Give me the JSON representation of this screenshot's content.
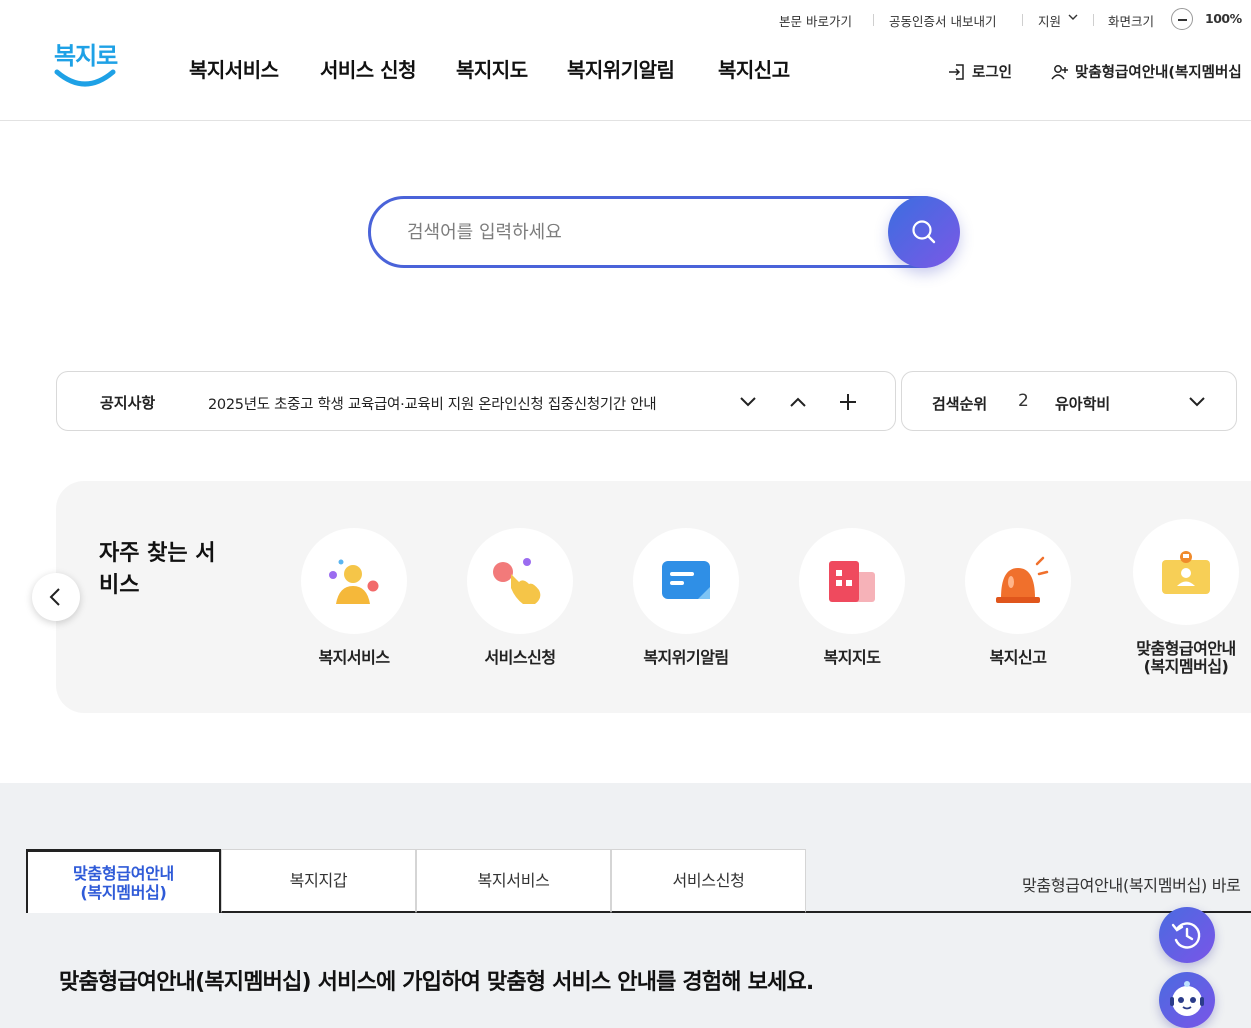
{
  "utility": {
    "skip_to_content": "본문 바로가기",
    "cert_export": "공동인증서 내보내기",
    "support": "지원",
    "screen_size": "화면크기",
    "zoom_level": "100%"
  },
  "header": {
    "logo_text": "복지로",
    "nav": [
      "복지서비스",
      "서비스 신청",
      "복지지도",
      "복지위기알림",
      "복지신고"
    ],
    "login": "로그인",
    "membership": "맞춤형급여안내(복지멤버십"
  },
  "search": {
    "placeholder": "검색어를 입력하세요"
  },
  "notice": {
    "label": "공지사항",
    "text": "2025년도 초중고 학생 교육급여·교육비 지원 온라인신청 집중신청기간 안내"
  },
  "ranking": {
    "label": "검색순위",
    "rank": "2",
    "term": "유아학비"
  },
  "frequent": {
    "title": "자주 찾는 서비스",
    "items": [
      {
        "label": "복지서비스",
        "icon": "person-icon"
      },
      {
        "label": "서비스신청",
        "icon": "tap-hand-icon"
      },
      {
        "label": "복지위기알림",
        "icon": "message-icon"
      },
      {
        "label": "복지지도",
        "icon": "building-map-icon"
      },
      {
        "label": "복지신고",
        "icon": "siren-icon"
      },
      {
        "label": "맞춤형급여안내\n(복지멤버십)",
        "icon": "id-badge-icon"
      }
    ]
  },
  "tabs": {
    "items": [
      "맞춤형급여안내\n(복지멤버십)",
      "복지지갑",
      "복지서비스",
      "서비스신청"
    ],
    "link": "맞춤형급여안내(복지멤버십) 바로"
  },
  "headline": "맞춤형급여안내(복지멤버십) 서비스에 가입하여 맞춤형 서비스 안내를 경험해 보세요.",
  "colors": {
    "accent": "#4a63d9",
    "active_tab": "#2f5bd8",
    "section_bg": "#f5f5f5",
    "lower_bg": "#eff1f3"
  }
}
